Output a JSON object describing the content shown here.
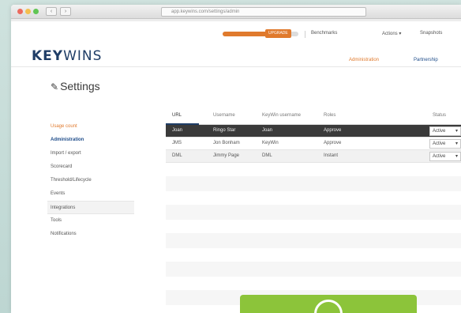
{
  "browser": {
    "nav_back": "‹",
    "nav_forward": "›",
    "url": "app.keywins.com/settings/admin"
  },
  "header": {
    "progress_fraction": 0.62,
    "progress_badge": "UPGRADE",
    "links": [
      "Benchmarks",
      "Actions ▾",
      "Snapshots"
    ]
  },
  "logo": {
    "bold": "KEY",
    "thin": "WINS"
  },
  "subnav": [
    "Administration",
    "Partnership"
  ],
  "page": {
    "title": "Settings"
  },
  "sidebar": {
    "items": [
      {
        "label": "Usage count",
        "style": "orange"
      },
      {
        "label": "Administration",
        "style": "bold"
      },
      {
        "label": "Import / export",
        "style": "plain"
      },
      {
        "label": "Scorecard",
        "style": "plain"
      },
      {
        "label": "Threshold/Lifecycle",
        "style": "plain"
      },
      {
        "label": "Events",
        "style": "plain"
      },
      {
        "label": "Integrations",
        "style": "sel"
      },
      {
        "label": "Tools",
        "style": "plain"
      },
      {
        "label": "Notifications",
        "style": "plain"
      }
    ]
  },
  "table": {
    "columns": [
      "URL",
      "Username",
      "KeyWin username",
      "Roles",
      "Status"
    ],
    "rows": [
      {
        "cells": [
          "Joan",
          "Ringo Star",
          "Joan",
          "Approve"
        ],
        "status": "Active",
        "style": "dark"
      },
      {
        "cells": [
          "JMS",
          "Jon Bonham",
          "KeyWin",
          "Approve"
        ],
        "status": "Active",
        "style": "plain"
      },
      {
        "cells": [
          "DML",
          "Jimmy Page",
          "DML",
          "Instant"
        ],
        "status": "Active",
        "style": "light"
      }
    ]
  },
  "colors": {
    "accent": "#e07a2d",
    "brand": "#1f3d66",
    "green": "#8cc43a"
  }
}
